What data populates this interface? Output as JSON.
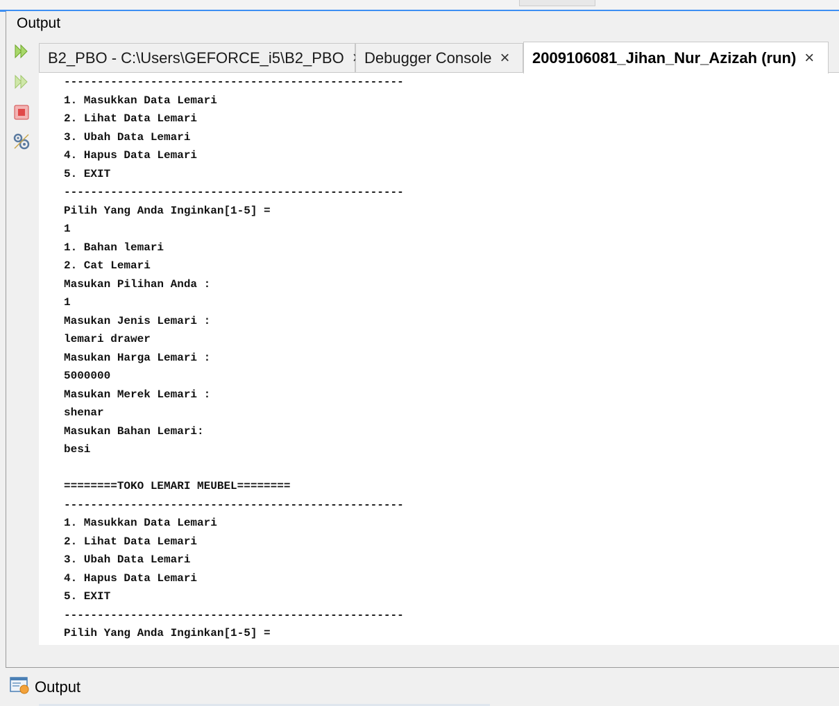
{
  "window": {
    "title": "Output",
    "accent_color": "#3d8ff3"
  },
  "toolbar": {
    "icons": [
      "rerun-icon",
      "rerun-with-params-icon",
      "stop-icon",
      "settings-icon"
    ],
    "stop_color": "#e04848",
    "rerun_color": "#8cc43c"
  },
  "tabs": [
    {
      "label": "B2_PBO - C:\\Users\\GEFORCE_i5\\B2_PBO",
      "close": "×",
      "active": false
    },
    {
      "label": "Debugger Console",
      "close": "×",
      "active": false
    },
    {
      "label": "2009106081_Jihan_Nur_Azizah (run)",
      "close": "×",
      "active": true
    }
  ],
  "console": {
    "lines": [
      "---------------------------------------------------",
      "1. Masukkan Data Lemari",
      "2. Lihat Data Lemari",
      "3. Ubah Data Lemari",
      "4. Hapus Data Lemari",
      "5. EXIT",
      "---------------------------------------------------",
      "Pilih Yang Anda Inginkan[1-5] =",
      "1",
      "1. Bahan lemari",
      "2. Cat Lemari",
      "Masukan Pilihan Anda :",
      "1",
      "Masukan Jenis Lemari :",
      "lemari drawer",
      "Masukan Harga Lemari :",
      "5000000",
      "Masukan Merek Lemari :",
      "shenar",
      "Masukan Bahan Lemari:",
      "besi",
      "",
      "========TOKO LEMARI MEUBEL========",
      "---------------------------------------------------",
      "1. Masukkan Data Lemari",
      "2. Lihat Data Lemari",
      "3. Ubah Data Lemari",
      "4. Hapus Data Lemari",
      "5. EXIT",
      "---------------------------------------------------",
      "Pilih Yang Anda Inginkan[1-5] ="
    ]
  },
  "bottom": {
    "tab_label": "Output",
    "icon": "output-window-icon"
  }
}
